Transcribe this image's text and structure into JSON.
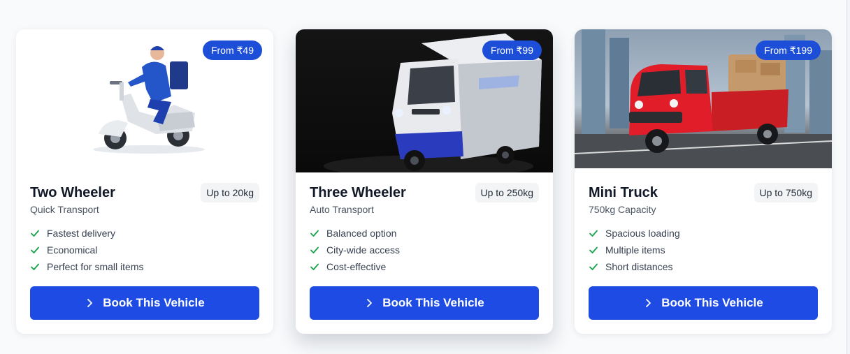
{
  "vehicles": [
    {
      "price": "From ₹49",
      "title": "Two Wheeler",
      "subtitle": "Quick Transport",
      "capacity": "Up to 20kg",
      "features": [
        "Fastest delivery",
        "Economical",
        "Perfect for small items"
      ],
      "cta": "Book This Vehicle",
      "image_icon": "scooter-delivery-illustration"
    },
    {
      "price": "From ₹99",
      "title": "Three Wheeler",
      "subtitle": "Auto Transport",
      "capacity": "Up to 250kg",
      "features": [
        "Balanced option",
        "City-wide access",
        "Cost-effective"
      ],
      "cta": "Book This Vehicle",
      "image_icon": "three-wheeler-cargo-photo"
    },
    {
      "price": "From ₹199",
      "title": "Mini Truck",
      "subtitle": "750kg Capacity",
      "capacity": "Up to 750kg",
      "features": [
        "Spacious loading",
        "Multiple items",
        "Short distances"
      ],
      "cta": "Book This Vehicle",
      "image_icon": "mini-truck-photo"
    }
  ],
  "colors": {
    "accent": "#1e4be4",
    "badge": "#1d4ed8",
    "check": "#16a34a",
    "title": "#111827"
  }
}
